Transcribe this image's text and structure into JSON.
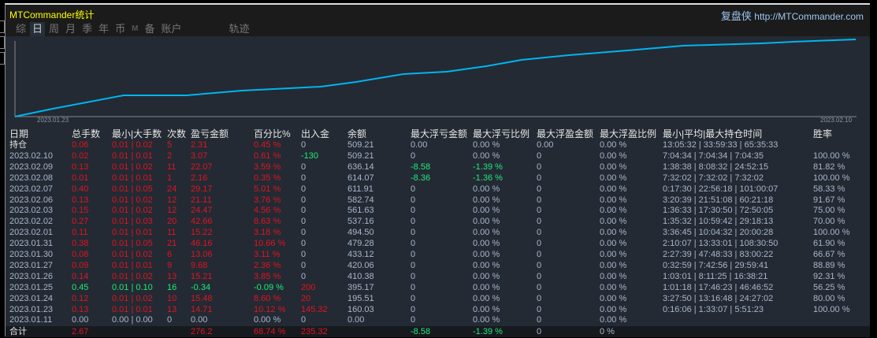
{
  "header": {
    "title": "MTCommander统计",
    "brand_cn": "复盘侠",
    "brand_url": "http://MTCommander.com"
  },
  "tabs": [
    {
      "label": "综",
      "active": false
    },
    {
      "label": "日",
      "active": true
    },
    {
      "label": "周",
      "active": false
    },
    {
      "label": "月",
      "active": false
    },
    {
      "label": "季",
      "active": false
    },
    {
      "label": "年",
      "active": false
    },
    {
      "label": "币",
      "active": false
    },
    {
      "label": "M",
      "active": false
    },
    {
      "label": "备",
      "active": false
    },
    {
      "label": "账户",
      "active": false
    },
    {
      "label": "轨迹",
      "active": false
    }
  ],
  "chart": {
    "start_date": "2023.01.23",
    "end_date": "2023.02.10",
    "line_color": "#00b4f0"
  },
  "table": {
    "headers": [
      "日期",
      "总手数",
      "最小|大手数",
      "次数",
      "盈亏金额",
      "百分比%",
      "出入金",
      "余额",
      "最大浮亏金额",
      "最大浮亏比例",
      "最大浮盈金额",
      "最大浮盈比例",
      "最小|平均|最大持仓时间",
      "胜率"
    ],
    "rows": [
      {
        "c": "red",
        "date": "持仓",
        "total": "0.06",
        "minmax": "0.01 | 0.02",
        "count": "5",
        "pnl": "2.31",
        "pct": "0.45 %",
        "inout": "0",
        "bal": "509.21",
        "fl": "0.00",
        "flp": "0.00 %",
        "fw": "0.00",
        "fwp": "0.00 %",
        "time": "13:05:32 | 33:59:33 | 65:35:33",
        "win": ""
      },
      {
        "c": "red",
        "date": "2023.02.10",
        "total": "0.02",
        "minmax": "0.01 | 0.01",
        "count": "2",
        "pnl": "3.07",
        "pct": "0.61 %",
        "inout": "-130",
        "bal": "509.21",
        "fl": "0",
        "flp": "0.00 %",
        "fw": "0",
        "fwp": "0.00 %",
        "time": "7:04:34 | 7:04:34 | 7:04:35",
        "win": "100.00 %"
      },
      {
        "c": "red",
        "date": "2023.02.09",
        "total": "0.13",
        "minmax": "0.01 | 0.02",
        "count": "11",
        "pnl": "22.07",
        "pct": "3.59 %",
        "inout": "0",
        "bal": "636.14",
        "fl": "-8.58",
        "flp": "-1.39 %",
        "fw": "0",
        "fwp": "0.00 %",
        "time": "1:38:38 | 8:08:32 | 24:52:15",
        "win": "81.82 %"
      },
      {
        "c": "red",
        "date": "2023.02.08",
        "total": "0.01",
        "minmax": "0.01 | 0.01",
        "count": "1",
        "pnl": "2.16",
        "pct": "0.35 %",
        "inout": "0",
        "bal": "614.07",
        "fl": "-8.36",
        "flp": "-1.36 %",
        "fw": "0",
        "fwp": "0.00 %",
        "time": "7:32:02 | 7:32:02 | 7:32:02",
        "win": "100.00 %"
      },
      {
        "c": "red",
        "date": "2023.02.07",
        "total": "0.40",
        "minmax": "0.01 | 0.05",
        "count": "24",
        "pnl": "29.17",
        "pct": "5.01 %",
        "inout": "0",
        "bal": "611.91",
        "fl": "0",
        "flp": "0.00 %",
        "fw": "0",
        "fwp": "0.00 %",
        "time": "0:17:30 | 22:56:18 | 101:00:07",
        "win": "58.33 %"
      },
      {
        "c": "red",
        "date": "2023.02.06",
        "total": "0.13",
        "minmax": "0.01 | 0.02",
        "count": "12",
        "pnl": "21.11",
        "pct": "3.76 %",
        "inout": "0",
        "bal": "582.74",
        "fl": "0",
        "flp": "0.00 %",
        "fw": "0",
        "fwp": "0.00 %",
        "time": "3:20:39 | 21:51:08 | 60:21:18",
        "win": "91.67 %"
      },
      {
        "c": "red",
        "date": "2023.02.03",
        "total": "0.15",
        "minmax": "0.01 | 0.02",
        "count": "12",
        "pnl": "24.47",
        "pct": "4.56 %",
        "inout": "0",
        "bal": "561.63",
        "fl": "0",
        "flp": "0.00 %",
        "fw": "0",
        "fwp": "0.00 %",
        "time": "1:36:33 | 17:30:50 | 72:50:05",
        "win": "75.00 %"
      },
      {
        "c": "red",
        "date": "2023.02.02",
        "total": "0.27",
        "minmax": "0.01 | 0.03",
        "count": "20",
        "pnl": "42.66",
        "pct": "8.63 %",
        "inout": "0",
        "bal": "537.16",
        "fl": "0",
        "flp": "0.00 %",
        "fw": "0",
        "fwp": "0.00 %",
        "time": "1:35:32 | 10:59:42 | 29:18:13",
        "win": "70.00 %"
      },
      {
        "c": "red",
        "date": "2023.02.01",
        "total": "0.11",
        "minmax": "0.01 | 0.01",
        "count": "11",
        "pnl": "15.22",
        "pct": "3.18 %",
        "inout": "0",
        "bal": "494.50",
        "fl": "0",
        "flp": "0.00 %",
        "fw": "0",
        "fwp": "0.00 %",
        "time": "3:36:45 | 10:04:32 | 20:00:28",
        "win": "100.00 %"
      },
      {
        "c": "red",
        "date": "2023.01.31",
        "total": "0.38",
        "minmax": "0.01 | 0.05",
        "count": "21",
        "pnl": "46.16",
        "pct": "10.66 %",
        "inout": "0",
        "bal": "479.28",
        "fl": "0",
        "flp": "0.00 %",
        "fw": "0",
        "fwp": "0.00 %",
        "time": "2:10:07 | 13:33:01 | 108:30:50",
        "win": "61.90 %"
      },
      {
        "c": "red",
        "date": "2023.01.30",
        "total": "0.08",
        "minmax": "0.01 | 0.02",
        "count": "6",
        "pnl": "13.06",
        "pct": "3.11 %",
        "inout": "0",
        "bal": "433.12",
        "fl": "0",
        "flp": "0.00 %",
        "fw": "0",
        "fwp": "0.00 %",
        "time": "2:27:39 | 47:48:33 | 83:00:22",
        "win": "66.67 %"
      },
      {
        "c": "red",
        "date": "2023.01.27",
        "total": "0.09",
        "minmax": "0.01 | 0.01",
        "count": "9",
        "pnl": "9.68",
        "pct": "2.36 %",
        "inout": "0",
        "bal": "420.06",
        "fl": "0",
        "flp": "0.00 %",
        "fw": "0",
        "fwp": "0.00 %",
        "time": "0:32:59 | 7:42:56 | 29:59:41",
        "win": "88.89 %"
      },
      {
        "c": "red",
        "date": "2023.01.26",
        "total": "0.14",
        "minmax": "0.01 | 0.02",
        "count": "13",
        "pnl": "15.21",
        "pct": "3.85 %",
        "inout": "0",
        "bal": "410.38",
        "fl": "0",
        "flp": "0.00 %",
        "fw": "0",
        "fwp": "0.00 %",
        "time": "1:03:01 | 8:11:25 | 16:38:21",
        "win": "92.31 %"
      },
      {
        "c": "green",
        "date": "2023.01.25",
        "total": "0.45",
        "minmax": "0.01 | 0.10",
        "count": "16",
        "pnl": "-0.34",
        "pct": "-0.09 %",
        "inout": "200",
        "bal": "395.17",
        "fl": "0",
        "flp": "0.00 %",
        "fw": "0",
        "fwp": "0.00 %",
        "time": "1:01:18 | 17:46:23 | 46:46:52",
        "win": "56.25 %"
      },
      {
        "c": "red",
        "date": "2023.01.24",
        "total": "0.12",
        "minmax": "0.01 | 0.02",
        "count": "10",
        "pnl": "15.48",
        "pct": "8.60 %",
        "inout": "20",
        "bal": "195.51",
        "fl": "0",
        "flp": "0.00 %",
        "fw": "0",
        "fwp": "0.00 %",
        "time": "3:27:50 | 13:16:48 | 24:27:02",
        "win": "80.00 %"
      },
      {
        "c": "red",
        "date": "2023.01.23",
        "total": "0.13",
        "minmax": "0.01 | 0.01",
        "count": "13",
        "pnl": "14.71",
        "pct": "10.12 %",
        "inout": "145.32",
        "bal": "160.03",
        "fl": "0",
        "flp": "0.00 %",
        "fw": "0",
        "fwp": "0.00 %",
        "time": "0:16:06 | 1:33:07 | 5:51:23",
        "win": "100.00 %"
      },
      {
        "c": "gray",
        "date": "2023.01.11",
        "total": "0.00",
        "minmax": "0.00 | 0.00",
        "count": "0",
        "pnl": "0.00",
        "pct": "0.00 %",
        "inout": "0",
        "bal": "0.00",
        "fl": "0",
        "flp": "0.00 %",
        "fw": "0",
        "fwp": "0.00 %",
        "time": "",
        "win": ""
      }
    ],
    "total": {
      "date": "合计",
      "total": "2.67",
      "minmax": "",
      "count": "",
      "pnl": "276.2",
      "pct": "68.74 %",
      "inout": "235.32",
      "bal": "",
      "fl": "-8.58",
      "flp": "-1.39 %",
      "fw": "0",
      "fwp": "0 %",
      "time": "",
      "win": ""
    }
  }
}
